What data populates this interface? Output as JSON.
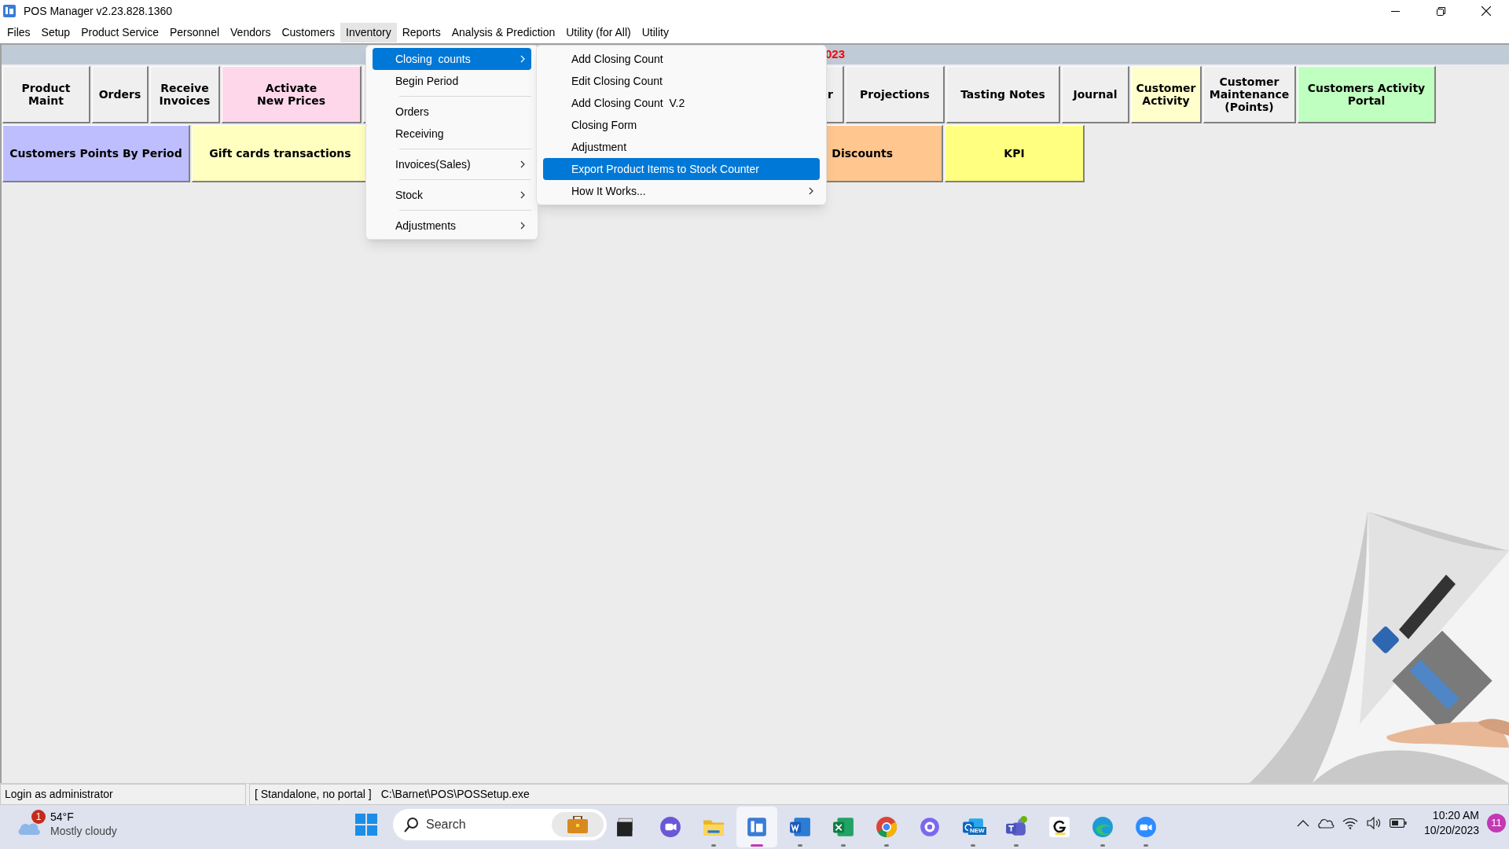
{
  "window": {
    "title": "POS Manager v2.23.828.1360"
  },
  "menu_bar": [
    {
      "label": "Files",
      "selected": false
    },
    {
      "label": "Setup",
      "selected": false
    },
    {
      "label": "Product Service",
      "selected": false
    },
    {
      "label": "Personnel",
      "selected": false
    },
    {
      "label": "Vendors",
      "selected": false
    },
    {
      "label": "Customers",
      "selected": false
    },
    {
      "label": "Inventory",
      "selected": true
    },
    {
      "label": "Reports",
      "selected": false
    },
    {
      "label": "Analysis & Prediction",
      "selected": false
    },
    {
      "label": "Utility (for All)",
      "selected": false
    },
    {
      "label": "Utility",
      "selected": false
    }
  ],
  "header": {
    "text": "023"
  },
  "button_rows": [
    [
      {
        "label": "Product\nMaint",
        "color": "#efefef",
        "kind": "full"
      },
      {
        "label": "Orders",
        "color": "#efefef",
        "kind": "full"
      },
      {
        "label": "Receive\nInvoices",
        "color": "#efefef",
        "kind": "full"
      },
      {
        "label": "Activate\nNew Prices",
        "color": "#ffd7ea",
        "kind": "full"
      },
      {
        "label": "r",
        "color": "#efefef",
        "kind": "covered"
      },
      {
        "label": "Projections",
        "color": "#efefef",
        "kind": "full"
      },
      {
        "label": "Tasting Notes",
        "color": "#efefef",
        "kind": "full"
      },
      {
        "label": "Journal",
        "color": "#efefef",
        "kind": "full"
      },
      {
        "label": "Customer\nActivity",
        "color": "#ffffcc",
        "kind": "full"
      },
      {
        "label": "Customer\nMaintenance\n(Points)",
        "color": "#efefef",
        "kind": "full"
      },
      {
        "label": "Customers Activity\nPortal",
        "color": "#bfffbf",
        "kind": "full"
      }
    ],
    [
      {
        "label": "Customers Points By Period",
        "color": "#bebeff",
        "kind": "full"
      },
      {
        "label": "Gift cards transactions",
        "color": "#ffffc0",
        "kind": "full"
      },
      {
        "label": "Discounts",
        "color": "#ffc68f",
        "kind": "covered"
      },
      {
        "label": "KPI",
        "color": "#ffff80",
        "kind": "full"
      }
    ]
  ],
  "inventory_menu": [
    {
      "kind": "item",
      "label": "Closing  counts",
      "selected": true,
      "submenu": true
    },
    {
      "kind": "item",
      "label": "Begin Period",
      "selected": false,
      "submenu": false
    },
    {
      "kind": "separator"
    },
    {
      "kind": "item",
      "label": "Orders",
      "selected": false,
      "submenu": false
    },
    {
      "kind": "item",
      "label": "Receiving",
      "selected": false,
      "submenu": false
    },
    {
      "kind": "separator"
    },
    {
      "kind": "item",
      "label": "Invoices(Sales)",
      "selected": false,
      "submenu": true
    },
    {
      "kind": "separator"
    },
    {
      "kind": "item",
      "label": "Stock",
      "selected": false,
      "submenu": true
    },
    {
      "kind": "separator"
    },
    {
      "kind": "item",
      "label": "Adjustments",
      "selected": false,
      "submenu": true
    }
  ],
  "closing_counts_menu": [
    {
      "label": "Add Closing Count",
      "selected": false,
      "submenu": false
    },
    {
      "label": "Edit Closing Count",
      "selected": false,
      "submenu": false
    },
    {
      "label": "Add Closing Count  V.2",
      "selected": false,
      "submenu": false
    },
    {
      "label": "Closing Form",
      "selected": false,
      "submenu": false
    },
    {
      "label": "Adjustment",
      "selected": false,
      "submenu": false
    },
    {
      "label": "Export Product Items to Stock Counter",
      "selected": true,
      "submenu": false
    },
    {
      "label": "How It Works...",
      "selected": false,
      "submenu": true
    }
  ],
  "status_bar": {
    "user": "Login as administrator",
    "mode": "[ Standalone, no portal ]",
    "path": "C:\\Barnet\\POS\\POSSetup.exe"
  },
  "taskbar": {
    "weather": {
      "badge": "1",
      "temperature": "54°F",
      "condition": "Mostly cloudy"
    },
    "search": {
      "placeholder": "Search"
    },
    "apps": [
      {
        "kind": "taskview",
        "running": false,
        "active": false
      },
      {
        "kind": "chat",
        "running": false,
        "active": false
      },
      {
        "kind": "explorer",
        "running": true,
        "active": false
      },
      {
        "kind": "pos",
        "running": true,
        "active": true
      },
      {
        "kind": "word",
        "running": true,
        "active": false
      },
      {
        "kind": "excel",
        "running": true,
        "active": false
      },
      {
        "kind": "chrome",
        "running": true,
        "active": false
      },
      {
        "kind": "flower",
        "running": false,
        "active": false
      },
      {
        "kind": "outlook",
        "running": true,
        "active": false,
        "badge": "NEW"
      },
      {
        "kind": "teams",
        "running": true,
        "active": false
      },
      {
        "kind": "gapp",
        "running": false,
        "active": false
      },
      {
        "kind": "edge",
        "running": true,
        "active": false
      },
      {
        "kind": "zoom",
        "running": true,
        "active": false
      }
    ],
    "time": "10:20 AM",
    "date": "10/20/2023",
    "notifications": "11"
  }
}
